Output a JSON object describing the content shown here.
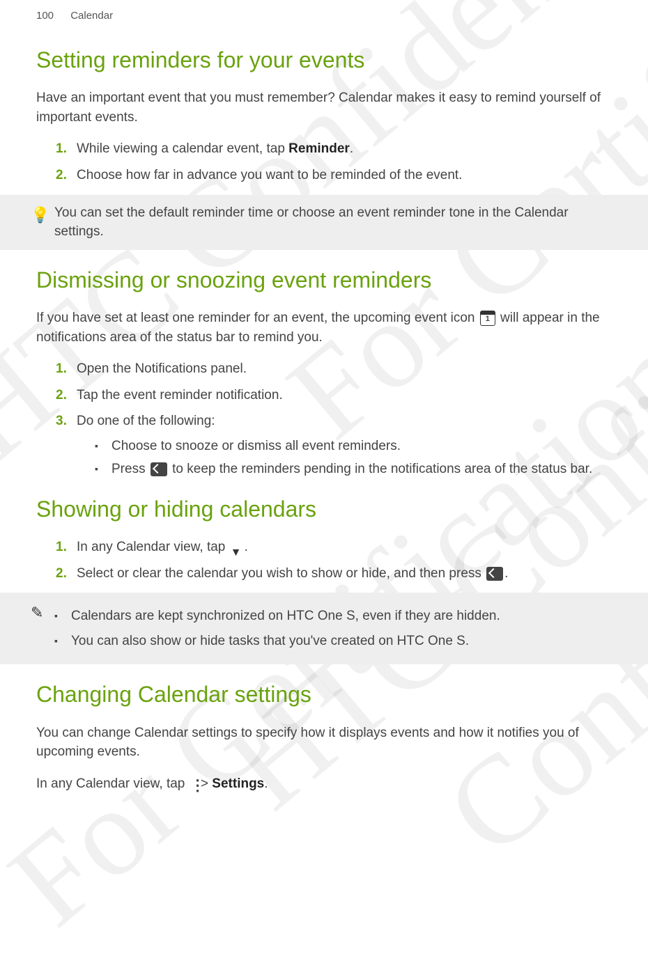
{
  "header": {
    "pageNumber": "100",
    "section": "Calendar"
  },
  "section1": {
    "title": "Setting reminders for your events",
    "intro": "Have an important event that you must remember? Calendar makes it easy to remind yourself of important events.",
    "step1_pre": "While viewing a calendar event, tap ",
    "step1_bold": "Reminder",
    "step1_post": ".",
    "step2": "Choose how far in advance you want to be reminded of the event.",
    "tip": "You can set the default reminder time or choose an event reminder tone in the Calendar settings."
  },
  "section2": {
    "title": "Dismissing or snoozing event reminders",
    "intro_pre": "If you have set at least one reminder for an event, the upcoming event icon ",
    "intro_post": " will appear in the notifications area of the status bar to remind you.",
    "step1": "Open the Notifications panel.",
    "step2": "Tap the event reminder notification.",
    "step3": "Do one of the following:",
    "bullet1": "Choose to snooze or dismiss all event reminders.",
    "bullet2_pre": "Press ",
    "bullet2_post": " to keep the reminders pending in the notifications area of the status bar."
  },
  "section3": {
    "title": "Showing or hiding calendars",
    "step1_pre": "In any Calendar view, tap ",
    "step1_post": ".",
    "step2_pre": "Select or clear the calendar you wish to show or hide, and then press ",
    "step2_post": ".",
    "tip1": "Calendars are kept synchronized on HTC One S, even if they are hidden.",
    "tip2": "You can also show or hide tasks that you've created on HTC One S."
  },
  "section4": {
    "title": "Changing Calendar settings",
    "intro": "You can change Calendar settings to specify how it displays events and how it notifies you of upcoming events.",
    "line2_pre": "In any Calendar view, tap ",
    "line2_mid": " > ",
    "line2_bold": "Settings",
    "line2_post": "."
  }
}
